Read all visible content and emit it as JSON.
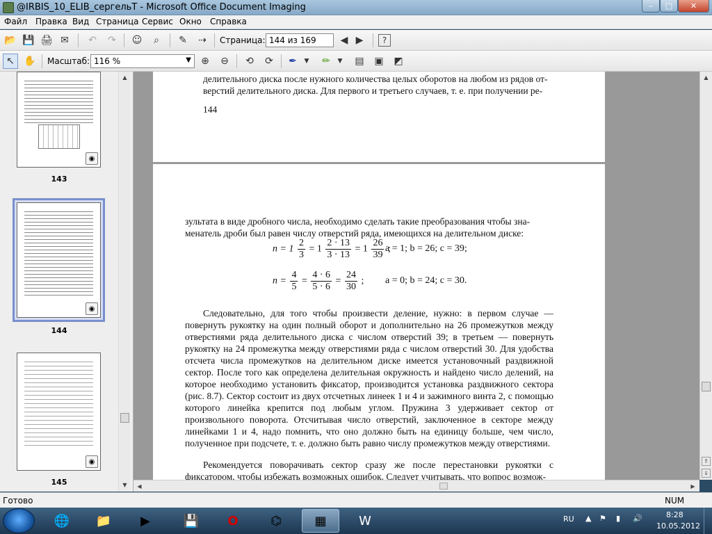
{
  "window": {
    "title": "@IRBIS_10_ELIB_сергельТ - Microsoft Office Document Imaging",
    "minimize": "–",
    "maximize": "□",
    "close": "✕"
  },
  "menu": [
    "Файл",
    "Правка",
    "Вид",
    "Страница",
    "Сервис",
    "Окно",
    "Справка"
  ],
  "toolbar1": {
    "page_label": "Страница:",
    "page_value": "144 из 169",
    "help": "?"
  },
  "toolbar2": {
    "zoom_label": "Масштаб:",
    "zoom_value": "116 %"
  },
  "thumbnails": [
    {
      "page": "143"
    },
    {
      "page": "144"
    },
    {
      "page": "145"
    }
  ],
  "page_top": {
    "lines": [
      "делительного диска после нужного количества целых оборотов на любом из рядов от-",
      "верстий делительного диска. Для первого и третьего случаев, т. е. при получении ре-"
    ],
    "page_number": "144"
  },
  "page_main": {
    "intro": [
      "зультата в виде дробного числа, необходимо сделать такие преобразования чтобы зна-",
      "менатель дроби был равен числу отверстий ряда, имеющихся на делительном диске:"
    ],
    "formula1": {
      "lhs": "n = 1",
      "f1_num": "2",
      "f1_den": "3",
      "eq2": "= 1",
      "f2_num": "2 · 13",
      "f2_den": "3 · 13",
      "eq3": "= 1",
      "f3_num": "26",
      "f3_den": "39",
      "tail": ";",
      "params": "a = 1; b = 26; c = 39;"
    },
    "formula2": {
      "lhs": "n =",
      "f1_num": "4",
      "f1_den": "5",
      "eq2": "=",
      "f2_num": "4 · 6",
      "f2_den": "5 · 6",
      "eq3": "=",
      "f3_num": "24",
      "f3_den": "30",
      "tail": ";",
      "params": "a = 0; b = 24; c = 30."
    },
    "paragraph1": "Следовательно, для того чтобы произвести деление, нужно: в первом случае — повернуть рукоятку на один полный оборот и дополнительно на 26 промежутков между отверстиями ряда делительного диска с числом отверстий 39; в третьем — повернуть рукоятку на 24 промежутка между отверстиями ряда с числом отверстий 30. Для удобства отсчета числа промежутков на делительном диске имеется установочный раздвижной сектор. После того как определена делительная окружность и найдено число делений, на которое необходимо установить фиксатор, производится установка раздвижного сектора (рис. 8.7). Сектор состоит из двух отсчетных линеек 1 и 4 и зажимного винта 2, с помощью которого линейка крепится под любым углом. Пружина 3 удерживает сектор от произвольного поворота. Отсчитывая число отверстий, заключенное в секторе между линейками 1 и 4, надо помнить, что оно должно быть на единицу больше, чем число, полученное при подсчете, т. е. должно быть равно числу промежутков между отверстиями.",
    "paragraph2": "Рекомендуется поворачивать сектор сразу же после перестановки рукоятки с фиксатором, чтобы избежать возможных ошибок. Следует учитывать, что вопрос возмож-"
  },
  "status": {
    "left": "Готово",
    "right": "NUM"
  },
  "tray": {
    "lang": "RU",
    "time": "8:28",
    "date": "10.05.2012"
  }
}
